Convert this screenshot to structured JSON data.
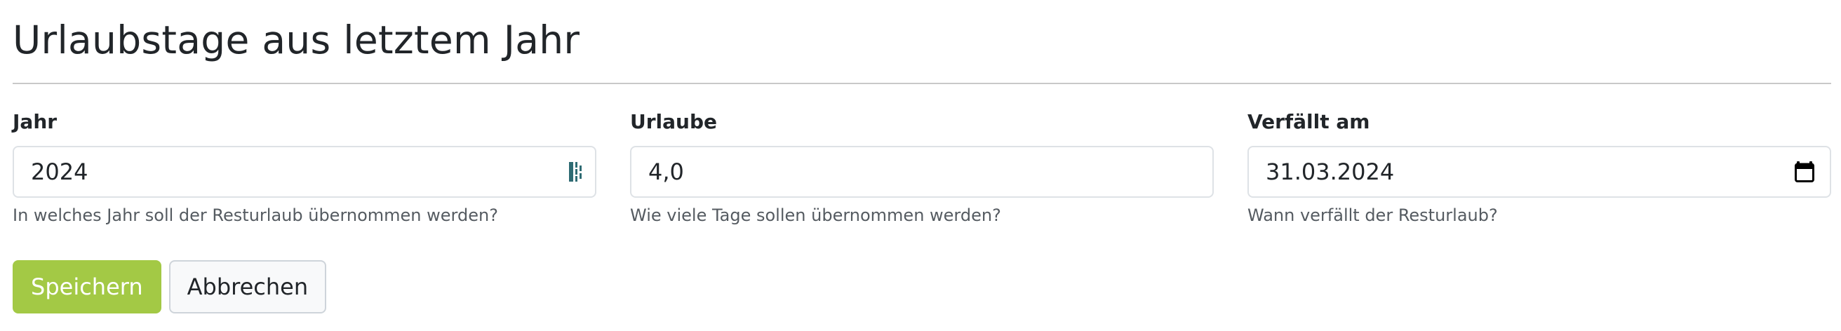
{
  "page": {
    "title": "Urlaubstage aus letztem Jahr"
  },
  "form": {
    "year": {
      "label": "Jahr",
      "value": "2024",
      "help": "In welches Jahr soll der Resturlaub übernommen werden?",
      "icon": "password-manager-icon"
    },
    "days": {
      "label": "Urlaube",
      "value": "4,0",
      "help": "Wie viele Tage sollen übernommen werden?"
    },
    "expires": {
      "label": "Verfällt am",
      "value": "31.03.2024",
      "help": "Wann verfällt der Resturlaub?",
      "icon": "calendar-icon"
    }
  },
  "actions": {
    "save_label": "Speichern",
    "cancel_label": "Abbrechen"
  },
  "colors": {
    "primary": "#a3c945",
    "text": "#212529",
    "muted": "#555b61",
    "border": "#dee2e6",
    "icon_accent": "#2e6b73"
  }
}
